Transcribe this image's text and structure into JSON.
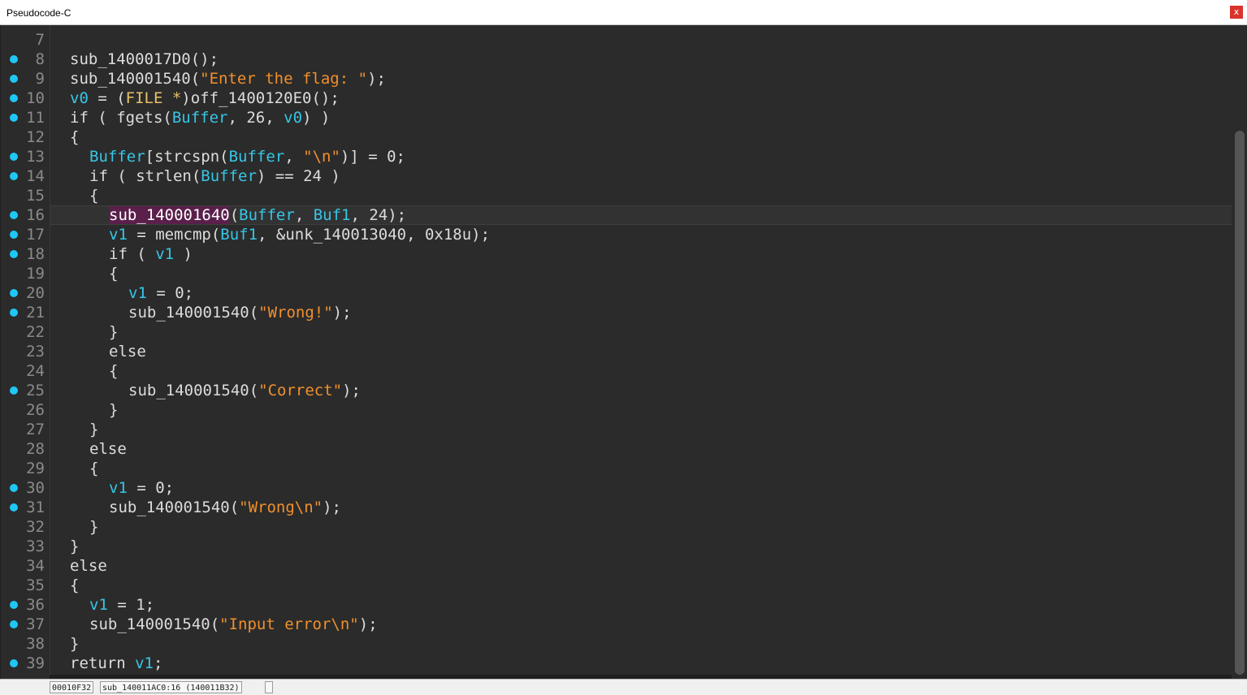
{
  "window": {
    "title": "Pseudocode-C",
    "close_label": "x"
  },
  "lines": [
    {
      "n": "7",
      "bp": false
    },
    {
      "n": "8",
      "bp": true
    },
    {
      "n": "9",
      "bp": true
    },
    {
      "n": "10",
      "bp": true
    },
    {
      "n": "11",
      "bp": true
    },
    {
      "n": "12",
      "bp": false
    },
    {
      "n": "13",
      "bp": true
    },
    {
      "n": "14",
      "bp": true
    },
    {
      "n": "15",
      "bp": false
    },
    {
      "n": "16",
      "bp": true
    },
    {
      "n": "17",
      "bp": true
    },
    {
      "n": "18",
      "bp": true
    },
    {
      "n": "19",
      "bp": false
    },
    {
      "n": "20",
      "bp": true
    },
    {
      "n": "21",
      "bp": true
    },
    {
      "n": "22",
      "bp": false
    },
    {
      "n": "23",
      "bp": false
    },
    {
      "n": "24",
      "bp": false
    },
    {
      "n": "25",
      "bp": true
    },
    {
      "n": "26",
      "bp": false
    },
    {
      "n": "27",
      "bp": false
    },
    {
      "n": "28",
      "bp": false
    },
    {
      "n": "29",
      "bp": false
    },
    {
      "n": "30",
      "bp": true
    },
    {
      "n": "31",
      "bp": true
    },
    {
      "n": "32",
      "bp": false
    },
    {
      "n": "33",
      "bp": false
    },
    {
      "n": "34",
      "bp": false
    },
    {
      "n": "35",
      "bp": false
    },
    {
      "n": "36",
      "bp": true
    },
    {
      "n": "37",
      "bp": true
    },
    {
      "n": "38",
      "bp": false
    },
    {
      "n": "39",
      "bp": true
    }
  ],
  "code": {
    "l8_call": "sub_1400017D0();",
    "l9_fn": "sub_140001540(",
    "l9_str": "\"Enter the flag: \"",
    "l9_end": ");",
    "l10_v0": "v0",
    "l10_eq": " = (",
    "l10_type": "FILE *",
    "l10_rest": ")off_1400120E0();",
    "l11_if": "if ( fgets(",
    "l11_buf": "Buffer",
    "l11_mid": ", 26, ",
    "l11_v0": "v0",
    "l11_end": ") )",
    "l12": "{",
    "l13_buf": "Buffer",
    "l13_a": "[strcspn(",
    "l13_buf2": "Buffer",
    "l13_b": ", ",
    "l13_str": "\"\\n\"",
    "l13_c": ")] = 0;",
    "l14_a": "if ( strlen(",
    "l14_buf": "Buffer",
    "l14_b": ") == 24 )",
    "l15": "{",
    "l16_fn": "sub_140001640",
    "l16_a": "(",
    "l16_buf": "Buffer",
    "l16_b": ", ",
    "l16_buf1": "Buf1",
    "l16_c": ", 24);",
    "l17_v1": "v1",
    "l17_a": " = memcmp(",
    "l17_buf1": "Buf1",
    "l17_b": ", &unk_140013040, 0x18u);",
    "l18_a": "if ( ",
    "l18_v1": "v1",
    "l18_b": " )",
    "l19": "{",
    "l20_v1": "v1",
    "l20_a": " = 0;",
    "l21_fn": "sub_140001540(",
    "l21_str": "\"Wrong!\"",
    "l21_end": ");",
    "l22": "}",
    "l23": "else",
    "l24": "{",
    "l25_fn": "sub_140001540(",
    "l25_str": "\"Correct\"",
    "l25_end": ");",
    "l26": "}",
    "l27": "}",
    "l28": "else",
    "l29": "{",
    "l30_v1": "v1",
    "l30_a": " = 0;",
    "l31_fn": "sub_140001540(",
    "l31_str": "\"Wrong\\n\"",
    "l31_end": ");",
    "l32": "}",
    "l33": "}",
    "l34": "else",
    "l35": "{",
    "l36_v1": "v1",
    "l36_a": " = 1;",
    "l37_fn": "sub_140001540(",
    "l37_str": "\"Input error\\n\"",
    "l37_end": ");",
    "l38": "}",
    "l39_a": "return ",
    "l39_v1": "v1",
    "l39_b": ";"
  },
  "status": {
    "offset": "00010F32",
    "location": "sub_140011AC0:16 (140011B32)"
  },
  "colors": {
    "variable": "#36c6e6",
    "string": "#f0902c",
    "type": "#e8c26a",
    "breakpoint": "#1ec7f5"
  }
}
